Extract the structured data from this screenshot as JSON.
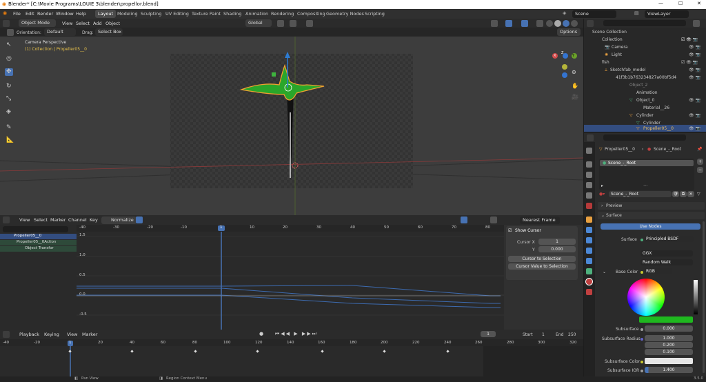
{
  "title": "Blender* [C:\\Movie Programs\\LOUIE 3\\blender\\propellor.blend]",
  "menu": [
    "File",
    "Edit",
    "Render",
    "Window",
    "Help"
  ],
  "workspaces": [
    "Layout",
    "Modeling",
    "Sculpting",
    "UV Editing",
    "Texture Paint",
    "Shading",
    "Animation",
    "Rendering",
    "Compositing",
    "Geometry Nodes",
    "Scripting"
  ],
  "scene": "Scene",
  "view_layer": "ViewLayer",
  "viewport": {
    "mode": "Object Mode",
    "menus": [
      "View",
      "Select",
      "Add",
      "Object"
    ],
    "transform": "Global",
    "orientation_label": "Orientation:",
    "orientation": "Default",
    "drag_label": "Drag:",
    "drag": "Select Box",
    "options": "Options",
    "camera_label": "Camera Perspective",
    "collection_label": "(1) Collection | Propeller05__0",
    "gizmo_axes": [
      "X",
      "Y",
      "Z"
    ]
  },
  "graph": {
    "menus": [
      "View",
      "Select",
      "Marker",
      "Channel",
      "Key"
    ],
    "normalize": "Normalize",
    "snap": "Nearest Frame",
    "frame_ticks": [
      "-40",
      "-30",
      "-20",
      "-10",
      "1",
      "10",
      "20",
      "30",
      "40",
      "50",
      "60",
      "70",
      "80"
    ],
    "value_ticks": [
      "1.5",
      "1.0",
      "0.5",
      "0.0",
      "-0.5"
    ],
    "channels": [
      "Propeller05__0",
      "Propeller05__0Action",
      "Object Transfor"
    ],
    "cursor_panel": {
      "title": "Show Cursor",
      "cursor_x_label": "Cursor X",
      "cursor_x": "1",
      "y_label": "Y",
      "y": "0.000",
      "btn1": "Cursor to Selection",
      "btn2": "Cursor Value to Selection"
    }
  },
  "timeline": {
    "menus": [
      "Playback",
      "Keying",
      "View",
      "Marker"
    ],
    "current": "1",
    "start_label": "Start",
    "start": "1",
    "end_label": "End",
    "end": "250",
    "ticks": [
      "-40",
      "-20",
      "1",
      "20",
      "40",
      "60",
      "80",
      "100",
      "120",
      "140",
      "160",
      "180",
      "200",
      "220",
      "240",
      "260",
      "280",
      "300",
      "320"
    ]
  },
  "outliner": {
    "rows": [
      {
        "label": "Scene Collection",
        "indent": 0
      },
      {
        "label": "Collection",
        "indent": 1
      },
      {
        "label": "Camera",
        "indent": 2
      },
      {
        "label": "Light",
        "indent": 2
      },
      {
        "label": "fish",
        "indent": 1
      },
      {
        "label": "Sketchfab_model",
        "indent": 2
      },
      {
        "label": "41f3b1b763234827a00bf5d4",
        "indent": 3
      },
      {
        "label": "Object_2",
        "indent": 4
      },
      {
        "label": "Animation",
        "indent": 5
      },
      {
        "label": "Object_0",
        "indent": 5
      },
      {
        "label": "Material__26",
        "indent": 6
      },
      {
        "label": "Cylinder",
        "indent": 5
      },
      {
        "label": "Cylinder",
        "indent": 6
      },
      {
        "label": "Propeller05__0",
        "indent": 6
      }
    ]
  },
  "properties": {
    "breadcrumb_obj": "Propeller05__0",
    "breadcrumb_mat": "Scene_-_Root",
    "slot": "Scene_-_Root",
    "material": "Scene_-_Root",
    "preview": "Preview",
    "surface": "Surface",
    "use_nodes": "Use Nodes",
    "surface_label": "Surface",
    "surface_value": "Principled BSDF",
    "distribution": "GGX",
    "subsurface_method": "Random Walk",
    "base_color_label": "Base Color",
    "base_color_mode": "RGB",
    "base_color_hex": "#1fb81f",
    "subsurface_label": "Subsurface",
    "subsurface": "0.000",
    "subsurface_radius_label": "Subsurface Radius",
    "subsurface_radius": [
      "1.000",
      "0.200",
      "0.100"
    ],
    "subsurface_color_label": "Subsurface Color",
    "subsurface_ior_label": "Subsurface IOR",
    "subsurface_ior": "1.400"
  },
  "status": {
    "pan": "Pan View",
    "context": "Region Context Menu",
    "version": "3.5.0"
  }
}
